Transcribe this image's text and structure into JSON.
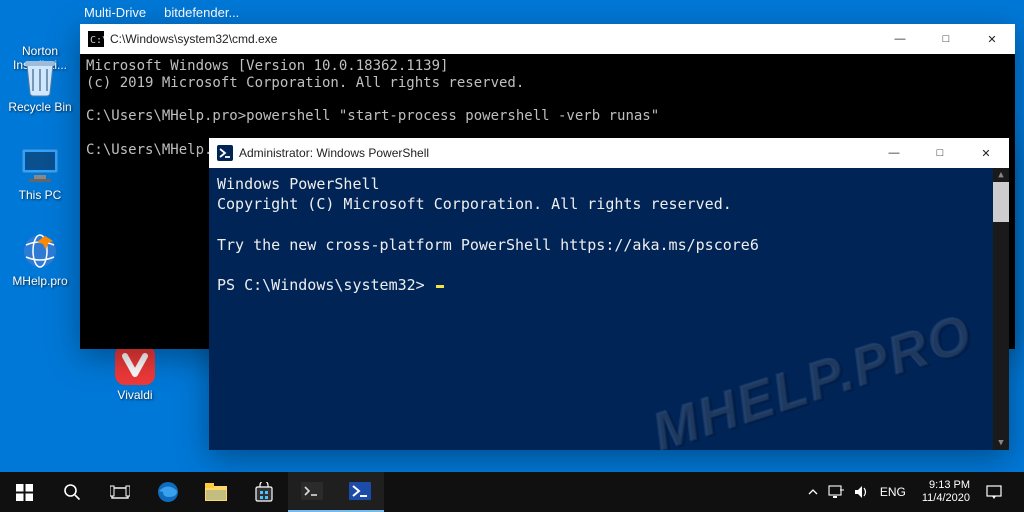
{
  "desktop": {
    "icons": [
      {
        "label": "Norton Installati..."
      },
      {
        "label": "Recycle Bin"
      },
      {
        "label": "This PC"
      },
      {
        "label": "MHelp.pro"
      },
      {
        "label": "Vivaldi"
      }
    ]
  },
  "topmenu": {
    "items": [
      "Multi-Drive",
      "bitdefender..."
    ]
  },
  "cmd": {
    "title": "C:\\Windows\\system32\\cmd.exe",
    "lines": [
      "Microsoft Windows [Version 10.0.18362.1139]",
      "(c) 2019 Microsoft Corporation. All rights reserved.",
      "",
      "C:\\Users\\MHelp.pro>powershell \"start-process powershell -verb runas\"",
      "",
      "C:\\Users\\MHelp.pro>"
    ]
  },
  "ps": {
    "title": "Administrator: Windows PowerShell",
    "lines": [
      "Windows PowerShell",
      "Copyright (C) Microsoft Corporation. All rights reserved.",
      "",
      "Try the new cross-platform PowerShell https://aka.ms/pscore6",
      "",
      "PS C:\\Windows\\system32> "
    ]
  },
  "watermark": "MHELP.PRO",
  "taskbar": {
    "buttons": [
      "start",
      "search",
      "taskview",
      "edge",
      "explorer",
      "store",
      "cmd",
      "powershell"
    ]
  },
  "tray": {
    "lang": "ENG",
    "time": "9:13 PM",
    "date": "11/4/2020"
  },
  "winctrl": {
    "min": "—",
    "max": "□",
    "close": "✕"
  }
}
